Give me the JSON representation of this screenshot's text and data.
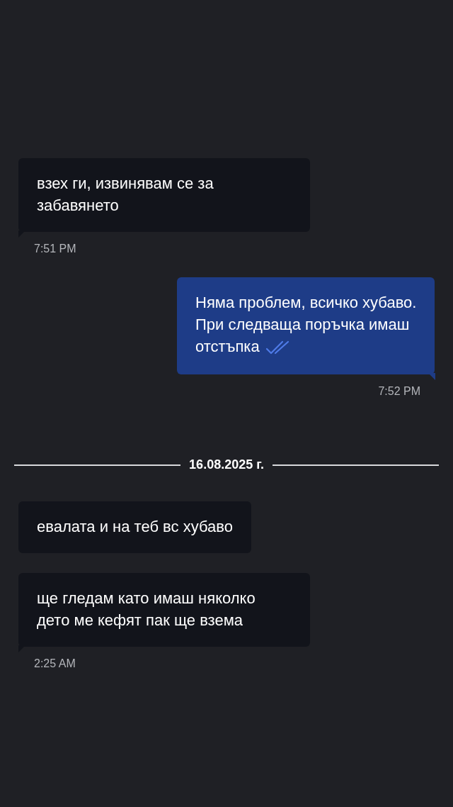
{
  "messages": [
    {
      "kind": "message",
      "outgoing": false,
      "text": "взех ги, извинявам се за забавянето",
      "time": "7:51 PM"
    },
    {
      "kind": "message",
      "outgoing": true,
      "text": "Няма проблем, всичко хубаво. При следваща поръчка имаш отстъпка",
      "read": true,
      "time": "7:52 PM"
    },
    {
      "kind": "date_divider",
      "text": "16.08.2025 г."
    },
    {
      "kind": "message",
      "outgoing": false,
      "text": "евалата и на теб вс хубаво"
    },
    {
      "kind": "message",
      "outgoing": false,
      "text": "ще гледам като имаш няколко дето ме кефят пак ще взема",
      "time": "2:25 AM"
    }
  ]
}
